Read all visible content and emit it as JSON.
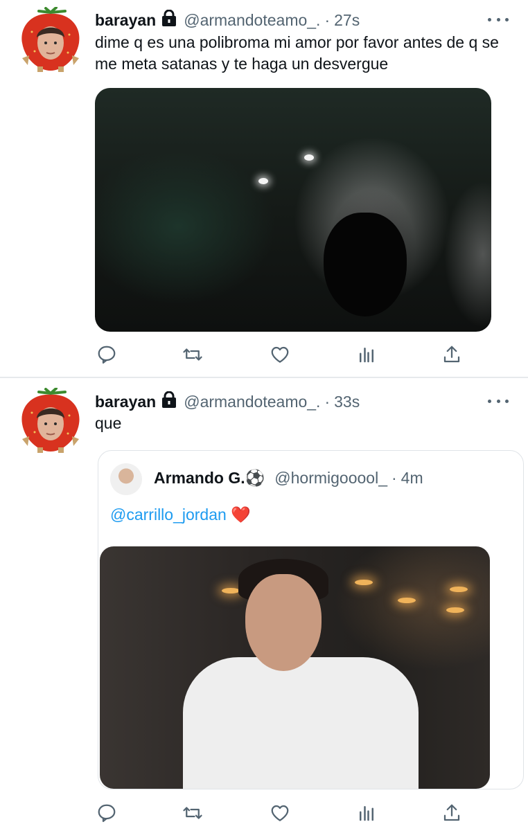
{
  "tweets": [
    {
      "name": "barayan",
      "handle": "@armandoteamo_.",
      "separator": "·",
      "time": "27s",
      "text": "dime q es una polibroma mi amor por favor antes de q se me meta satanas y te haga un desvergue"
    },
    {
      "name": "barayan",
      "handle": "@armandoteamo_.",
      "separator": "·",
      "time": "33s",
      "text": "que",
      "quote": {
        "name": "Armando G.",
        "name_emoji": "⚽",
        "handle": "@hormigooool_",
        "separator": "·",
        "time": "4m",
        "mention": "@carrillo_jordan",
        "emoji": "❤️"
      }
    }
  ],
  "icons": [
    "reply-icon",
    "retweet-icon",
    "like-icon",
    "analytics-icon",
    "share-icon",
    "lock-icon",
    "more-icon"
  ],
  "colors": {
    "text": "#0f1419",
    "muted": "#536471",
    "link": "#1d9bf0",
    "border": "#dfe3e7"
  }
}
